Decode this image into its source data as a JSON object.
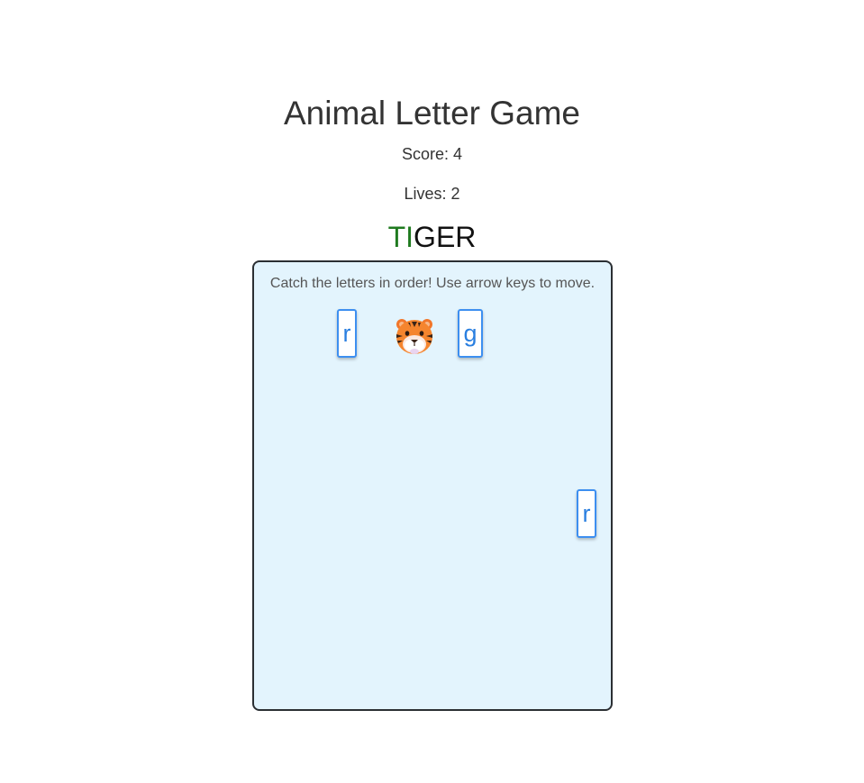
{
  "game": {
    "title": "Animal Letter Game",
    "score": "Score: 4",
    "lives": "Lives: 2",
    "word": {
      "caught": "TI",
      "remaining": "GER"
    },
    "instructions": "Catch the letters in order! Use arrow keys to move.",
    "falling_letters": [
      "r",
      "g",
      "r"
    ],
    "player_icon": "tiger-face-icon",
    "colors": {
      "caught": "#1f7a1f",
      "remaining": "#111111",
      "field_background": "#e3f4fd",
      "letter_border": "#3d8ff0",
      "letter_text": "#2a7fe0"
    }
  }
}
